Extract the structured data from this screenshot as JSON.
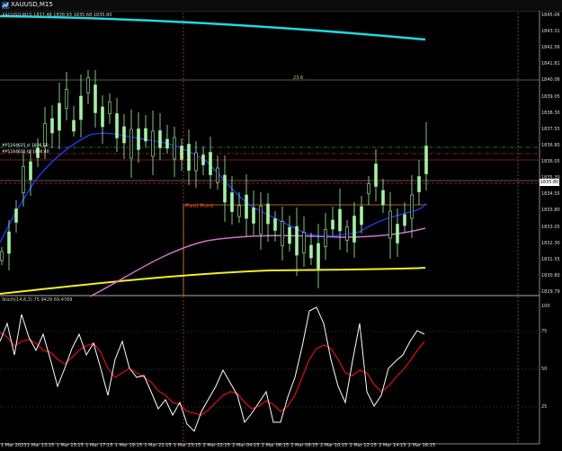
{
  "window": {
    "title": "XAUUSD,M15"
  },
  "chart_header": {
    "symbol_line": "XAUUSD,M15  1837.48 1838.93 1835.68 1835.80"
  },
  "price_axis": {
    "labels": [
      "1845.06",
      "1843.31",
      "1842.56",
      "1841.81",
      "1840.06",
      "1839.05",
      "1838.30",
      "1837.55",
      "1836.80",
      "1836.05",
      "1835.30",
      "1834.55",
      "1833.80",
      "1833.05",
      "1832.30",
      "1831.55",
      "1830.80",
      "1829.79"
    ],
    "current_price": "1835.80"
  },
  "indicator": {
    "label": "Stoch(14,6,3) 75.9429 69.4769",
    "levels": [
      "100",
      "75",
      "50",
      "25",
      "0"
    ]
  },
  "time_axis": {
    "labels": [
      "1 Mar 2023",
      "1 Mar 13:15",
      "1 Mar 15:15",
      "1 Mar 17:15",
      "1 Mar 19:15",
      "1 Mar 21:15",
      "1 Mar 23:15",
      "2 Mar 02:15",
      "2 Mar 04:15",
      "2 Mar 06:15",
      "2 Mar 08:15",
      "2 Mar 10:15",
      "2 Mar 12:15",
      "2 Mar 14:15",
      "2 Mar 16:15"
    ]
  },
  "annotations": {
    "pivot_label": "Pivot Point",
    "fib_label": "23.6",
    "hline_label_1": "#P1164625 sl 1836.50",
    "hline_label_2": "#P1164625 tp 1836.40"
  },
  "colors": {
    "candles": "#a6f0a6",
    "ma_fast": "#1e3cff",
    "ma_mid": "#d070d0",
    "ma_slow": "#f0f020",
    "ma_top": "#20d8e0",
    "stoch_main": "#ffffff",
    "stoch_signal": "#d01010",
    "pivot": "#d88a20"
  }
}
